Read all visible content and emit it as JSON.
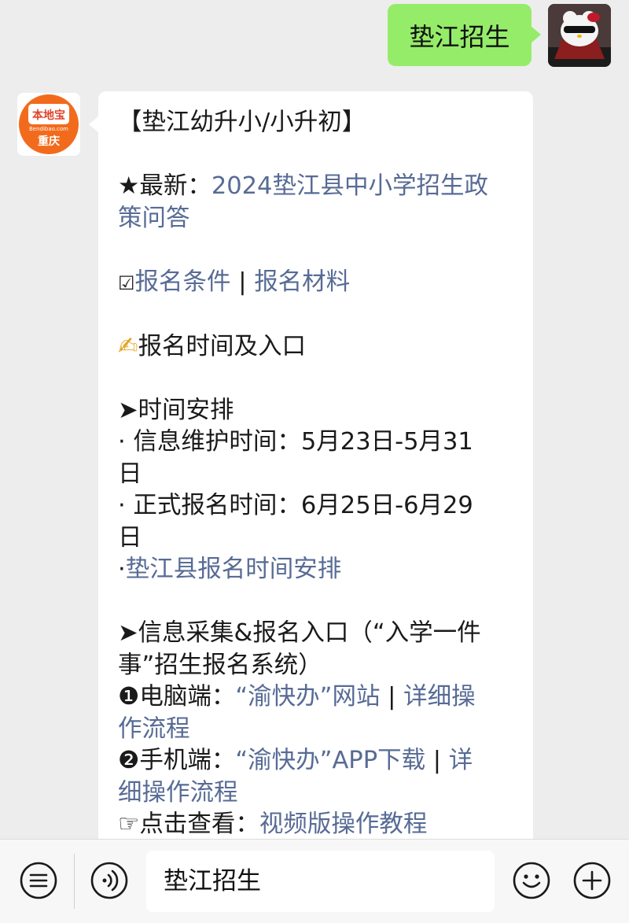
{
  "user_message": {
    "text": "垫江招生"
  },
  "bot_message": {
    "logo_text_top": "本地宝",
    "logo_text_mid": "Bendibao.com",
    "logo_text_bottom": "重庆",
    "title": "【垫江幼升小/小升初】",
    "latest_prefix": "★最新：",
    "latest_link_1": "2024垫江县中小学招生政",
    "latest_link_2": "策问答",
    "check_glyph": "☑",
    "conditions_link": "报名条件",
    "pipe": " | ",
    "materials_link": "报名材料",
    "writing_glyph": "✍",
    "time_entry_heading": "报名时间及入口",
    "schedule_heading": "➤时间安排",
    "info_time_1": "· 信息维护时间：5月23日-5月31",
    "info_time_2": "日",
    "formal_time_1": "· 正式报名时间：6月25日-6月29",
    "formal_time_2": "日",
    "dot": "·",
    "county_schedule_link": "垫江县报名时间安排",
    "entry_heading_1": "➤信息采集&报名入口（“入学一件",
    "entry_heading_2": "事”招生报名系统）",
    "pc_prefix": "❶电脑端：",
    "pc_link": "“渝快办”网站",
    "pc_pipe": " | ",
    "pc_detail_1": "详细操",
    "pc_detail_2": "作流程",
    "mobile_prefix": "❷手机端：",
    "mobile_link": "“渝快办”APP下载",
    "mobile_pipe": " | ",
    "mobile_detail_1": "详",
    "mobile_detail_2": "细操作流程",
    "video_prefix": "☞点击查看：",
    "video_link": "视频版操作教程"
  },
  "input_bar": {
    "input_value": "垫江招生",
    "menu_icon": "menu-list-icon",
    "voice_icon": "voice-icon",
    "emoji_icon": "emoji-icon",
    "plus_icon": "plus-icon"
  },
  "colors": {
    "user_bubble": "#95ec69",
    "link": "#576b95",
    "background": "#ededed",
    "logo_orange": "#f26b1d"
  }
}
